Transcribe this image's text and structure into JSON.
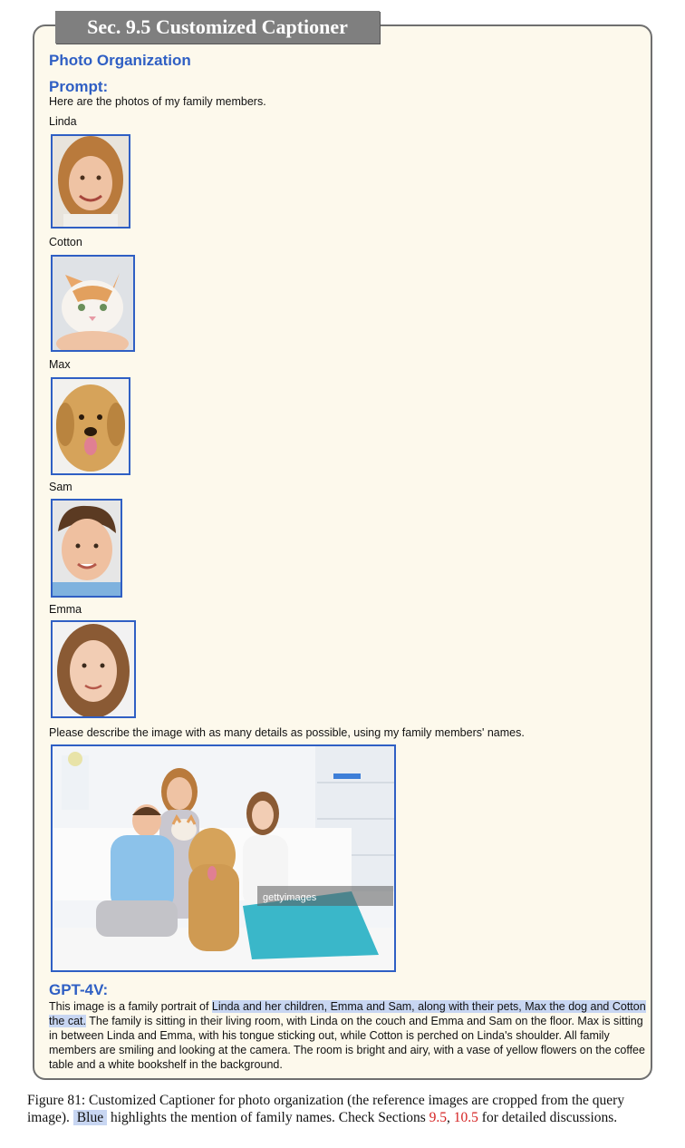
{
  "section_tab": "Sec. 9.5 Customized Captioner",
  "heading": "Photo Organization",
  "prompt_label": "Prompt:",
  "prompt_intro": "Here are the photos of my family members.",
  "names": [
    "Linda",
    "Cotton",
    "Max",
    "Sam",
    "Emma"
  ],
  "prompt_request": "Please describe the image with as many details as possible, using my family members' names.",
  "watermark": "gettyimages",
  "response_label": "GPT-4V:",
  "response": {
    "p1": "This image is a family portrait of ",
    "h1": "Linda and her children, Emma and Sam, along with their pets, Max the dog and Cotton the cat.",
    "p2": " The family is sitting in their living room, with Linda on the couch and Emma and Sam on the floor. Max is sitting in between Linda and Emma, with his tongue sticking out, while Cotton is perched on Linda's shoulder. All family members are smiling and looking at the camera. The room is bright and airy, with a vase of yellow flowers on the coffee table and a white bookshelf in the background."
  },
  "caption": {
    "a": "Figure 81: Customized Captioner for photo organization (the reference images are cropped from the query image).",
    "blue_word": "Blue",
    "b": "highlights the mention of family names. Check Sections",
    "ref1": "9.5",
    "comma": ",",
    "ref2": "10.5",
    "c": "for detailed discussions."
  },
  "colors": {
    "accent_blue": "#2f5fc4",
    "highlight": "#c8d6f2",
    "panel_bg": "#fdf9ec",
    "ref_red": "#d42121"
  }
}
